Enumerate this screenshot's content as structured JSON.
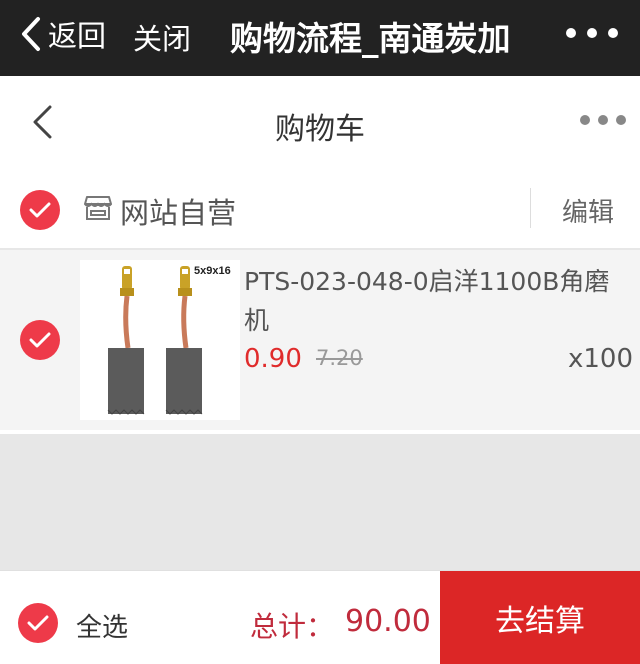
{
  "wechat_bar": {
    "back_label": "返回",
    "close_label": "关闭",
    "title": "购物流程_南通炭加"
  },
  "header": {
    "title": "购物车"
  },
  "store": {
    "name": "网站自营",
    "edit_label": "编辑",
    "checked": true
  },
  "product": {
    "name": "PTS-023-048-0启洋1100B角磨机",
    "price": "0.90",
    "original_price": "7.20",
    "quantity": "x100",
    "image_label": "5x9x16",
    "checked": true
  },
  "footer": {
    "select_all_label": "全选",
    "total_label": "总计：",
    "total_value": "90.00",
    "checkout_label": "去结算"
  },
  "colors": {
    "accent_red": "#ee3a49",
    "price_red": "#e02b2b",
    "checkout_red": "#dc2626",
    "topbar_dark": "#222222"
  },
  "icons": [
    "chevron-left-icon",
    "more-dots-icon",
    "checkmark-icon",
    "store-icon"
  ]
}
